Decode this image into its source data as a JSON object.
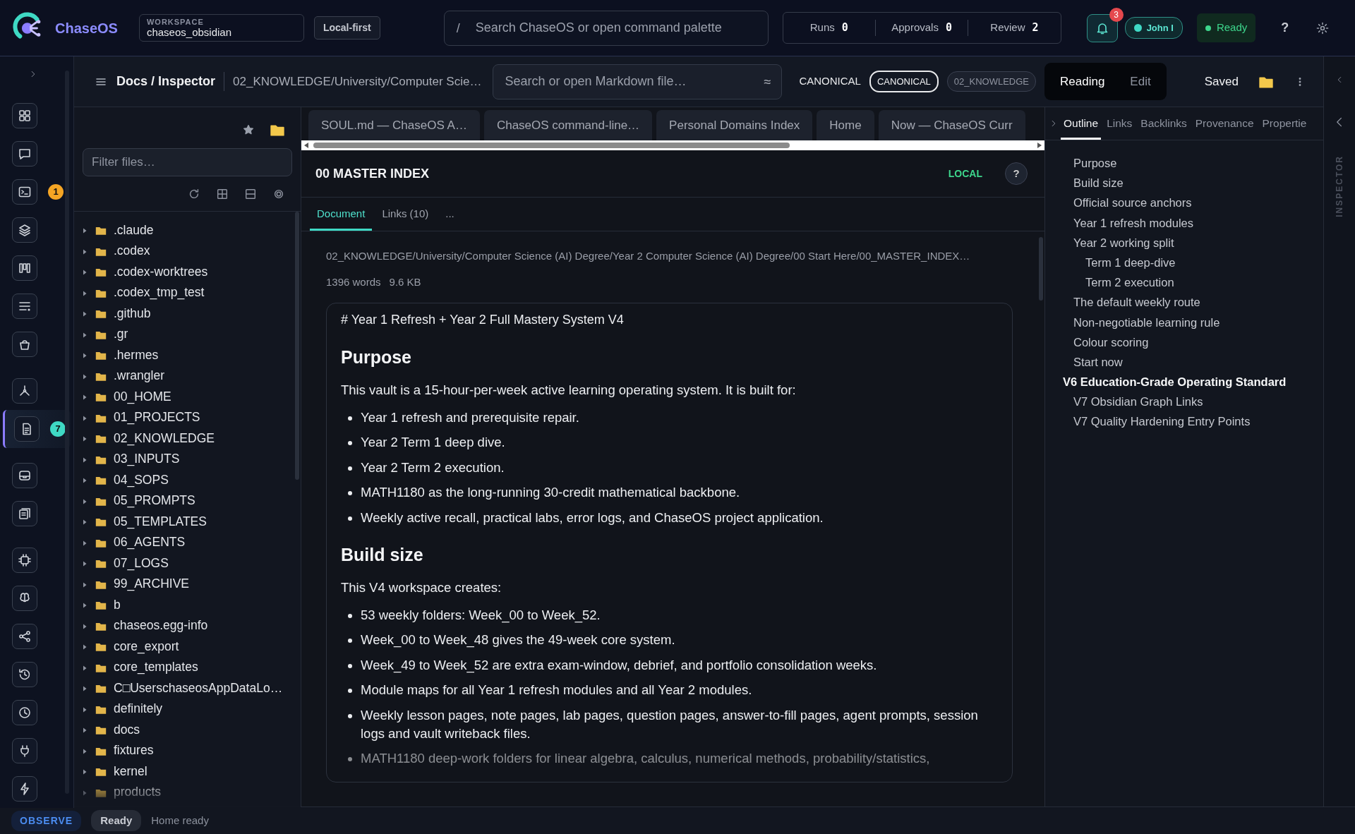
{
  "topbar": {
    "app_name": "ChaseOS",
    "workspace": {
      "label": "WORKSPACE",
      "value": "chaseos_obsidian"
    },
    "mode_badge": "Local-first",
    "search": {
      "prefix": "/",
      "placeholder": "Search ChaseOS or open command palette"
    },
    "counters": [
      {
        "label": "Runs",
        "value": "0"
      },
      {
        "label": "Approvals",
        "value": "0"
      },
      {
        "label": "Review",
        "value": "2"
      }
    ],
    "notifications": "3",
    "user": "John I",
    "status": "Ready",
    "help": "?"
  },
  "rail": [
    {
      "selected": false
    },
    {
      "selected": false
    },
    {
      "selected": false,
      "badge": {
        "text": "1",
        "color": "#f5a524"
      }
    },
    {
      "selected": false
    },
    {
      "selected": false
    },
    {
      "selected": false
    },
    {
      "selected": false
    },
    {
      "selected": false
    },
    {
      "selected": true,
      "badge": {
        "text": "7",
        "color": "#3fd9c4"
      }
    },
    {
      "selected": false
    },
    {
      "selected": false
    },
    {
      "selected": false
    },
    {
      "selected": false
    },
    {
      "selected": false
    },
    {
      "selected": false
    },
    {
      "selected": false
    },
    {
      "selected": false
    },
    {
      "selected": false
    }
  ],
  "docs_header": {
    "title": "Docs / Inspector",
    "path": "02_KNOWLEDGE/University/Computer Scie…",
    "search": {
      "placeholder": "Search or open Markdown file…",
      "suffix": "≈"
    },
    "canonical_label": "CANONICAL",
    "chips": [
      {
        "label": "CANONICAL",
        "selected": true
      },
      {
        "label": "02_KNOWLEDGE",
        "selected": false
      }
    ],
    "modes": [
      {
        "label": "Reading",
        "selected": true
      },
      {
        "label": "Edit",
        "selected": false
      }
    ],
    "save_state": "Saved"
  },
  "files": {
    "filter_placeholder": "Filter files…",
    "items": [
      ".claude",
      ".codex",
      ".codex-worktrees",
      ".codex_tmp_test",
      ".github",
      ".gr",
      ".hermes",
      ".wrangler",
      "00_HOME",
      "01_PROJECTS",
      "02_KNOWLEDGE",
      "03_INPUTS",
      "04_SOPS",
      "05_PROMPTS",
      "05_TEMPLATES",
      "06_AGENTS",
      "07_LOGS",
      "99_ARCHIVE",
      "b",
      "chaseos.egg-info",
      "core_export",
      "core_templates",
      "C□UserschaseosAppDataLo…",
      "definitely",
      "docs",
      "fixtures",
      "kernel",
      "products"
    ]
  },
  "tabs": [
    {
      "label": "SOUL.md — ChaseOS A…"
    },
    {
      "label": "ChaseOS command-line…"
    },
    {
      "label": "Personal Domains Index"
    },
    {
      "label": "Home"
    },
    {
      "label": "Now — ChaseOS Curr"
    }
  ],
  "document": {
    "title": "00 MASTER INDEX",
    "badge": "LOCAL",
    "help": "?",
    "subtabs": [
      {
        "label": "Document",
        "selected": true
      },
      {
        "label": "Links (10)",
        "selected": false
      },
      {
        "label": "...",
        "selected": false
      }
    ],
    "path": "02_KNOWLEDGE/University/Computer Science (AI) Degree/Year 2 Computer Science (AI) Degree/00 Start Here/00_MASTER_INDEX…",
    "words": "1396 words",
    "size": "9.6 KB",
    "first_line": "# Year 1 Refresh + Year 2 Full Mastery System V4",
    "sections": [
      {
        "heading": "Purpose",
        "intro": "This vault is a 15-hour-per-week active learning operating system. It is built for:",
        "bullets": [
          "Year 1 refresh and prerequisite repair.",
          "Year 2 Term 1 deep dive.",
          "Year 2 Term 2 execution.",
          "MATH1180 as the long-running 30-credit mathematical backbone.",
          "Weekly active recall, practical labs, error logs, and ChaseOS project application."
        ]
      },
      {
        "heading": "Build size",
        "intro": "This V4 workspace creates:",
        "bullets": [
          "53 weekly folders: Week_00 to Week_52.",
          "Week_00 to Week_48 gives the 49-week core system.",
          "Week_49 to Week_52 are extra exam-window, debrief, and portfolio consolidation weeks.",
          "Module maps for all Year 1 refresh modules and all Year 2 modules.",
          "Weekly lesson pages, note pages, lab pages, question pages, answer-to-fill pages, agent prompts, session logs and vault writeback files.",
          "MATH1180 deep-work folders for linear algebra, calculus, numerical methods, probability/statistics,"
        ]
      }
    ]
  },
  "inspector": {
    "tabs": [
      {
        "label": "Outline",
        "selected": true
      },
      {
        "label": "Links",
        "selected": false
      },
      {
        "label": "Backlinks",
        "selected": false
      },
      {
        "label": "Provenance",
        "selected": false
      },
      {
        "label": "Propertie",
        "selected": false
      }
    ],
    "outline": [
      {
        "label": "Purpose",
        "kind": "section"
      },
      {
        "label": "Build size",
        "kind": "section"
      },
      {
        "label": "Official source anchors",
        "kind": "section"
      },
      {
        "label": "Year 1 refresh modules",
        "kind": "section"
      },
      {
        "label": "Year 2 working split",
        "kind": "section",
        "children": [
          {
            "label": "Term 1 deep-dive",
            "kind": "subsection"
          },
          {
            "label": "Term 2 execution",
            "kind": "subsection"
          }
        ]
      },
      {
        "label": "The default weekly route",
        "kind": "section"
      },
      {
        "label": "Non-negotiable learning rule",
        "kind": "section"
      },
      {
        "label": "Colour scoring",
        "kind": "section"
      },
      {
        "label": "Start now",
        "kind": "section"
      },
      {
        "label": "V6 Education-Grade Operating Standard",
        "kind": "major"
      },
      {
        "label": "V7 Obsidian Graph Links",
        "kind": "section"
      },
      {
        "label": "V7 Quality Hardening Entry Points",
        "kind": "section"
      }
    ],
    "rail_label": "INSPECTOR"
  },
  "status_bar": {
    "mode": "OBSERVE",
    "state": "Ready",
    "message": "Home ready"
  }
}
